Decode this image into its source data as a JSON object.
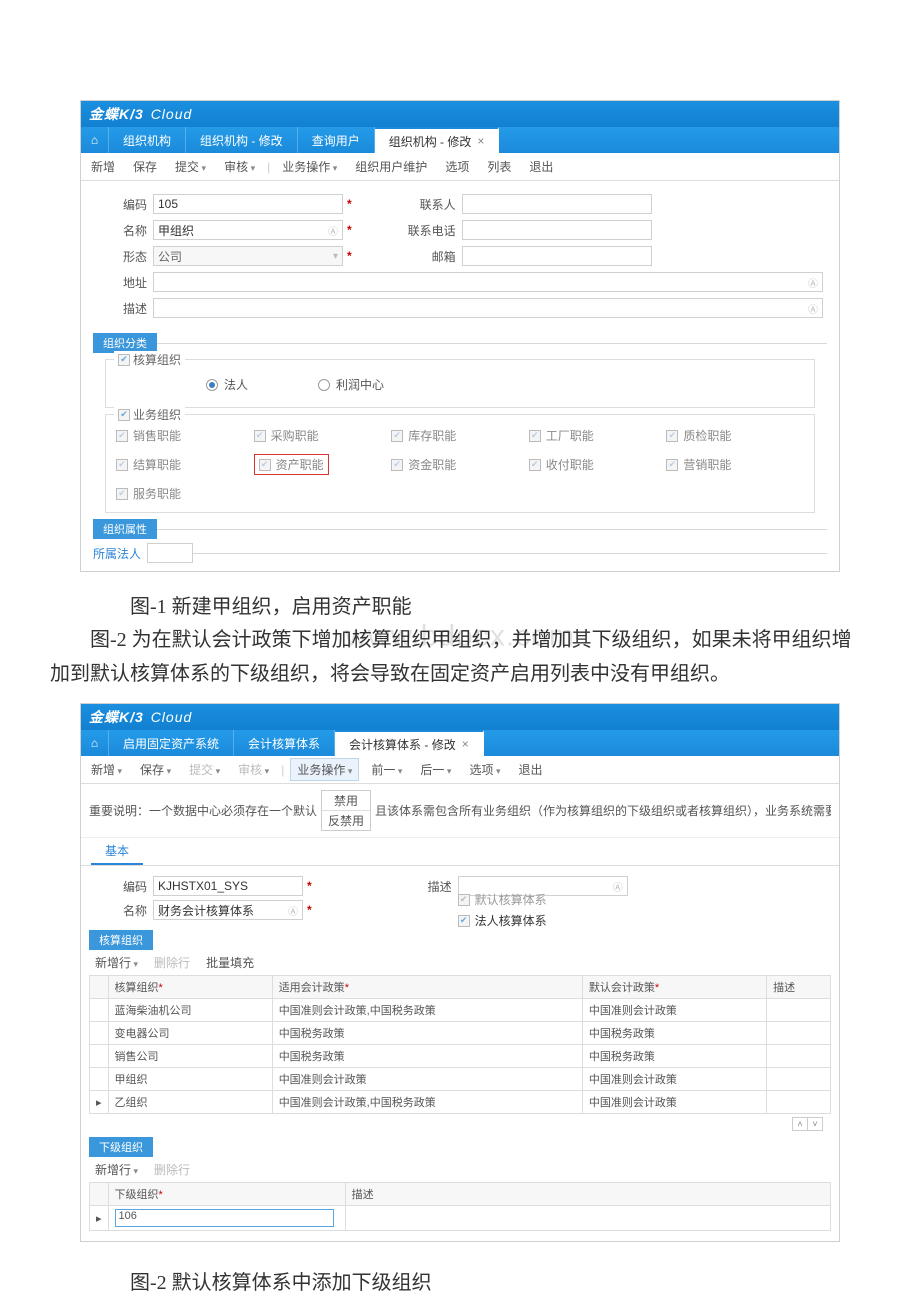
{
  "brand": {
    "k3": "金蝶K/3",
    "cloud": "Cloud"
  },
  "shot1": {
    "tabs": {
      "t1": "组织机构",
      "t2": "组织机构 - 修改",
      "t3": "查询用户",
      "t4": "组织机构 - 修改"
    },
    "toolbar": {
      "new": "新增",
      "save": "保存",
      "submit": "提交",
      "audit": "审核",
      "bizop": "业务操作",
      "orguser": "组织用户维护",
      "option": "选项",
      "list": "列表",
      "exit": "退出"
    },
    "labels": {
      "code": "编码",
      "name": "名称",
      "form": "形态",
      "addr": "地址",
      "desc": "描述",
      "contact": "联系人",
      "phone": "联系电话",
      "mail": "邮箱"
    },
    "values": {
      "code": "105",
      "name": "甲组织",
      "form": "公司"
    },
    "section_class": "组织分类",
    "fieldset_acct": "核算组织",
    "radio_legal": "法人",
    "radio_profit": "利润中心",
    "fieldset_biz": "业务组织",
    "chk": {
      "sale": "销售职能",
      "purchase": "采购职能",
      "stock": "库存职能",
      "factory": "工厂职能",
      "qc": "质检职能",
      "settle": "结算职能",
      "asset": "资产职能",
      "fund": "资金职能",
      "pay": "收付职能",
      "market": "营销职能",
      "service": "服务职能"
    },
    "section_attr": "组织属性",
    "attr_owner": "所属法人"
  },
  "caption1": "图-1 新建甲组织，启用资产职能",
  "paragraph1": "图-2 为在默认会计政策下增加核算组织甲组织，并增加其下级组织，如果未将甲组织增加到默认核算体系的下级组织，将会导致在固定资产启用列表中没有甲组织。",
  "watermark": "www.bdocx.com",
  "shot2": {
    "tabs": {
      "t1": "启用固定资产系统",
      "t2": "会计核算体系",
      "t3": "会计核算体系 - 修改"
    },
    "toolbar": {
      "new": "新增",
      "save": "保存",
      "submit": "提交",
      "audit": "审核",
      "bizop": "业务操作",
      "prev": "前一",
      "next": "后一",
      "option": "选项",
      "exit": "退出"
    },
    "note_prefix": "重要说明：一个数据中心必须存在一个默认",
    "note_btn1": "禁用",
    "note_btn2": "反禁用",
    "note_suffix": "且该体系需包含所有业务组织（作为核算组织的下级组织或者核算组织），业务系统需要通过默认核算体系中业务组织所属核算",
    "subtab_basic": "基本",
    "labels": {
      "code": "编码",
      "name": "名称",
      "desc": "描述"
    },
    "values": {
      "code": "KJHSTX01_SYS",
      "name": "财务会计核算体系"
    },
    "chk_default": "默认核算体系",
    "chk_legal": "法人核算体系",
    "panel1": "核算组织",
    "gridtb": {
      "addrow": "新增行",
      "delrow": "删除行",
      "fill": "批量填充"
    },
    "cols": {
      "org": "核算组织",
      "policy": "适用会计政策",
      "default": "默认会计政策",
      "desc": "描述"
    },
    "rows": [
      {
        "org": "蓝海柴油机公司",
        "policy": "中国准则会计政策,中国税务政策",
        "default": "中国准则会计政策"
      },
      {
        "org": "变电器公司",
        "policy": "中国税务政策",
        "default": "中国税务政策"
      },
      {
        "org": "销售公司",
        "policy": "中国税务政策",
        "default": "中国税务政策"
      },
      {
        "org": "甲组织",
        "policy": "中国准则会计政策",
        "default": "中国准则会计政策"
      },
      {
        "org": "乙组织",
        "policy": "中国准则会计政策,中国税务政策",
        "default": "中国准则会计政策"
      }
    ],
    "panel2": "下级组织",
    "gridtb2": {
      "addrow": "新增行",
      "delrow": "删除行"
    },
    "cols2": {
      "org": "下级组织",
      "desc": "描述"
    },
    "subrow_value": "106"
  },
  "caption2": "图-2 默认核算体系中添加下级组织"
}
